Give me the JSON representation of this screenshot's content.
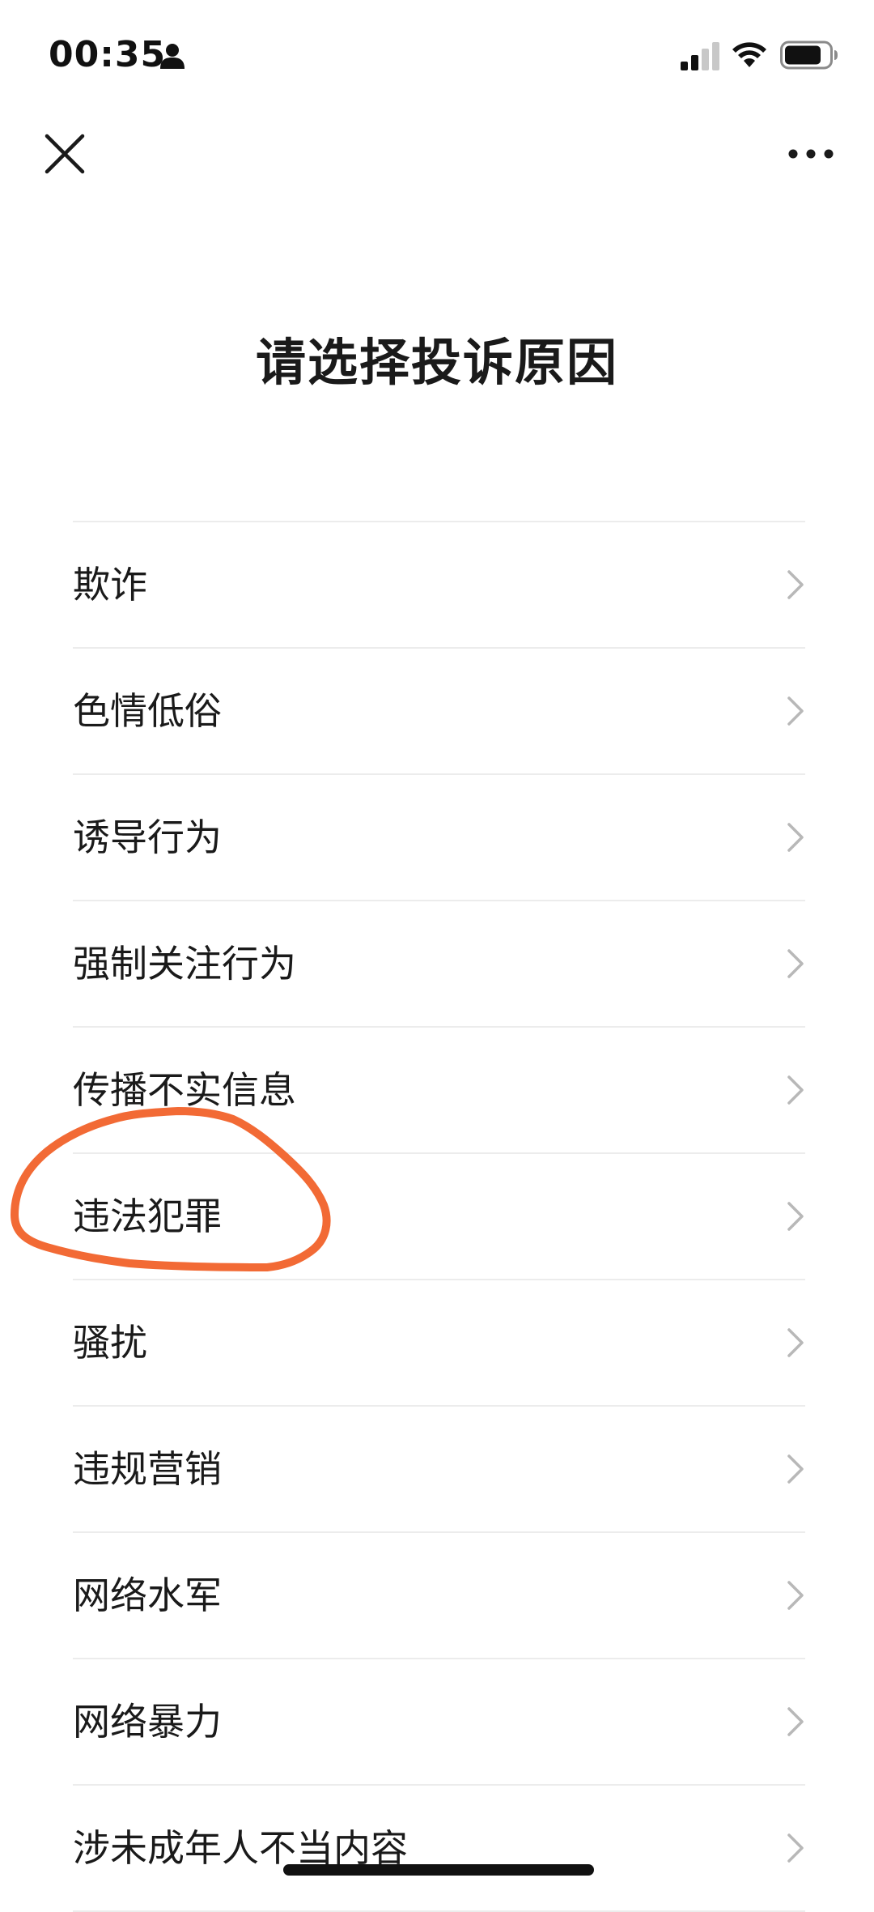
{
  "status_bar": {
    "time": "00:35"
  },
  "icons": {
    "person": "person-icon",
    "signal": "cellular-signal-icon",
    "wifi": "wifi-icon",
    "battery": "battery-icon",
    "close": "close-icon",
    "more": "more-icon",
    "chevron": "chevron-right-icon"
  },
  "page": {
    "title": "请选择投诉原因"
  },
  "reasons": [
    "欺诈",
    "色情低俗",
    "诱导行为",
    "强制关注行为",
    "传播不实信息",
    "违法犯罪",
    "骚扰",
    "违规营销",
    "网络水军",
    "网络暴力",
    "涉未成年人不当内容"
  ],
  "colors": {
    "annotation": "#f26a35",
    "divider": "#ececec",
    "chevron": "#b8b8b8",
    "text": "#1a1a1a"
  }
}
